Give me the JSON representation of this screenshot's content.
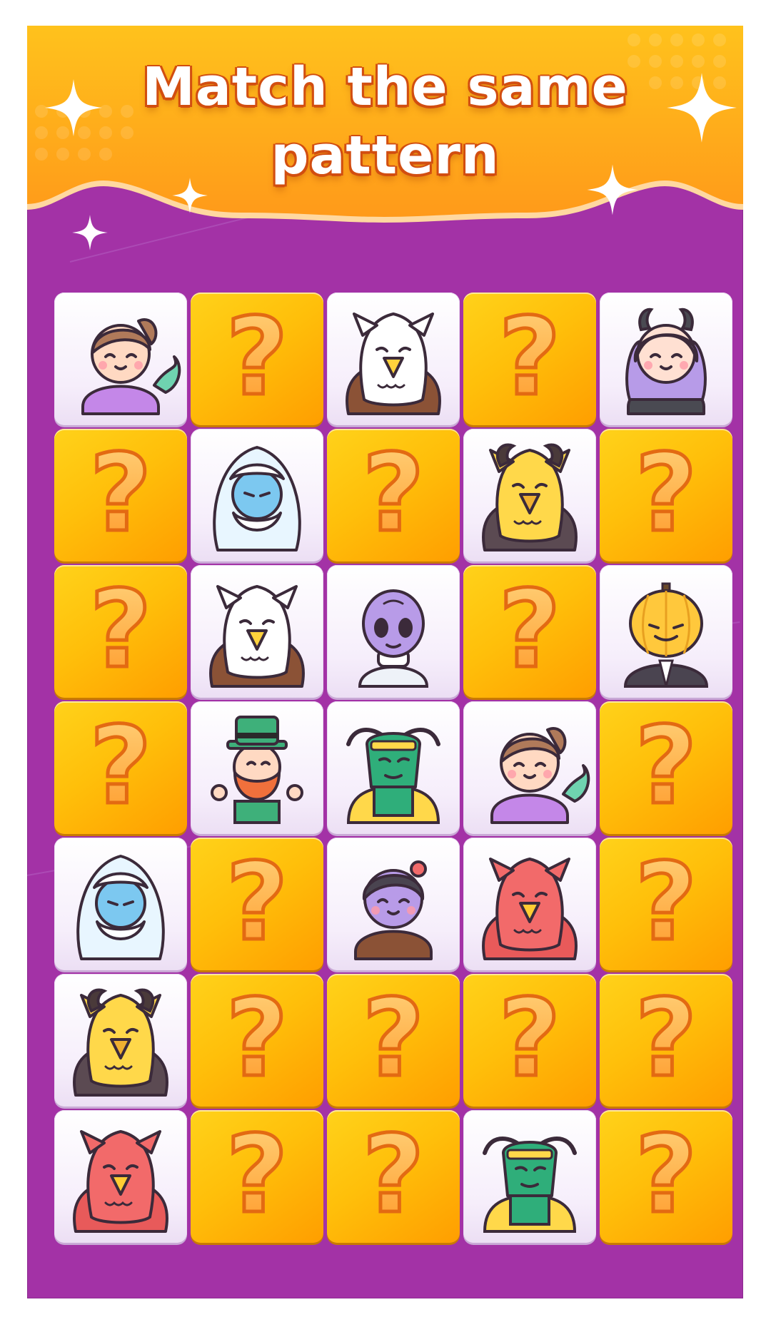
{
  "header": {
    "title_line1": "Match the same",
    "title_line2": "pattern"
  },
  "colors": {
    "background": "#a332a6",
    "banner": "#ffa21a",
    "card_hidden": "#ffc20e",
    "card_revealed": "#f6eefb",
    "question_mark": "#ff9a2a"
  },
  "board": {
    "rows": 7,
    "cols": 5,
    "hidden_symbol": "?",
    "cards": [
      [
        "mermaid-icon",
        "hidden",
        "griffin-white-icon",
        "hidden",
        "demon-girl-icon"
      ],
      [
        "hidden",
        "yeti-icon",
        "hidden",
        "manticore-icon",
        "hidden"
      ],
      [
        "hidden",
        "griffin-white-icon",
        "alien-icon",
        "hidden",
        "pumpkin-head-icon"
      ],
      [
        "hidden",
        "leprechaun-icon",
        "dragon-icon",
        "mermaid-icon",
        "hidden"
      ],
      [
        "yeti-icon",
        "hidden",
        "zombie-girl-icon",
        "phoenix-icon",
        "hidden"
      ],
      [
        "manticore-icon",
        "hidden",
        "hidden",
        "hidden",
        "hidden"
      ],
      [
        "phoenix-icon",
        "hidden",
        "hidden",
        "dragon-icon",
        "hidden"
      ]
    ]
  }
}
